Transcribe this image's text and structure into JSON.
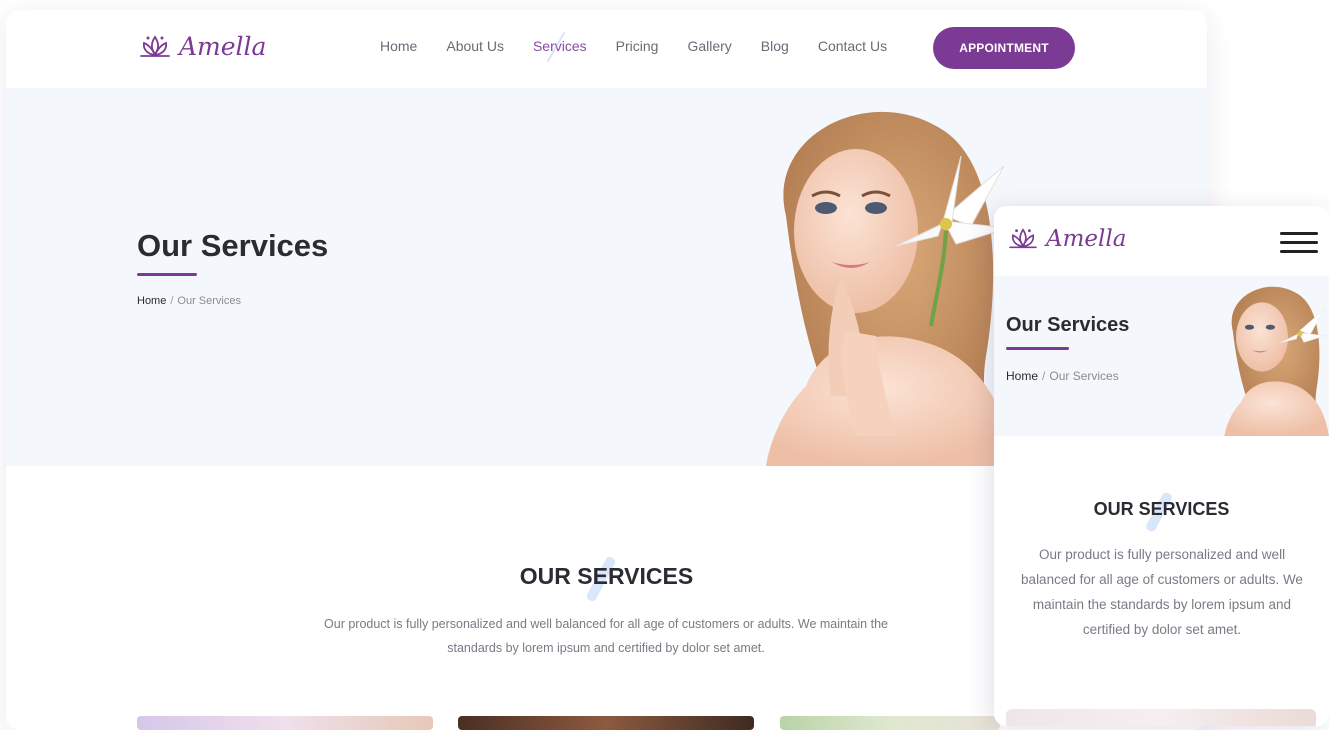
{
  "brand": {
    "name": "Amella",
    "color": "#7b3a94"
  },
  "nav": {
    "items": [
      {
        "label": "Home"
      },
      {
        "label": "About Us"
      },
      {
        "label": "Services",
        "active": true
      },
      {
        "label": "Pricing"
      },
      {
        "label": "Gallery"
      },
      {
        "label": "Blog"
      },
      {
        "label": "Contact Us"
      }
    ],
    "cta_label": "APPOINTMENT"
  },
  "hero": {
    "title": "Our Services",
    "breadcrumb": {
      "home": "Home",
      "separator": "/",
      "current": "Our Services"
    }
  },
  "section": {
    "title": "OUR SERVICES",
    "description": "Our product is fully personalized and well balanced for all age of customers or adults. We maintain the standards by lorem ipsum and certified by dolor set amet."
  },
  "mobile": {
    "menu_icon": "hamburger-menu-icon"
  },
  "colors": {
    "accent": "#7b3a94",
    "hero_bg": "#f4f7fb",
    "text_dark": "#2b2b33",
    "text_muted": "#7a7a86"
  }
}
